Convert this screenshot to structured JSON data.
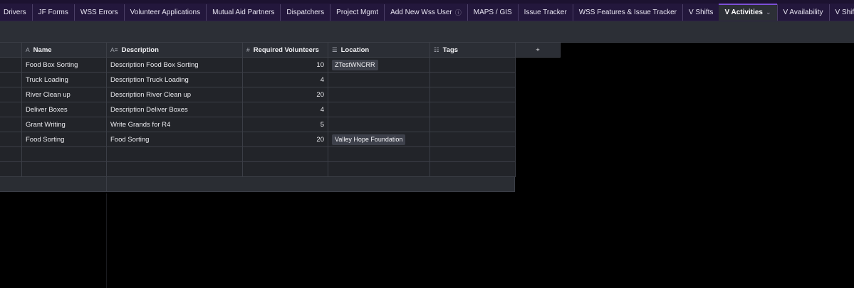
{
  "tabs": [
    {
      "label": "Drivers"
    },
    {
      "label": "JF Forms"
    },
    {
      "label": "WSS Errors"
    },
    {
      "label": "Volunteer Applications"
    },
    {
      "label": "Mutual Aid Partners"
    },
    {
      "label": "Dispatchers"
    },
    {
      "label": "Project Mgmt"
    },
    {
      "label": "Add New Wss User",
      "icon": "info-icon",
      "glyph": "ⓘ"
    },
    {
      "label": "MAPS / GIS"
    },
    {
      "label": "Issue Tracker"
    },
    {
      "label": "WSS Features & Issue Tracker"
    },
    {
      "label": "V Shifts"
    },
    {
      "label": "V Activities",
      "active": true,
      "icon": "chevron-down-icon",
      "glyph": "⌄"
    },
    {
      "label": "V Availability"
    },
    {
      "label": "V Shift Assignment"
    }
  ],
  "tab_overflow": {
    "icon": "chevron-down-icon",
    "glyph": "⌄"
  },
  "tab_add": {
    "icon": "plus-icon",
    "glyph": "+"
  },
  "colors": {
    "tabbar_bg": "#23173c",
    "active_accent": "#7c4fd6",
    "grid_bg": "#222429",
    "grid_border": "#3b3e46"
  },
  "columns": [
    {
      "label": "",
      "icon": ""
    },
    {
      "label": "Name",
      "icon": "text-field-icon",
      "glyph": "A"
    },
    {
      "label": "Description",
      "icon": "long-text-field-icon",
      "glyph": "A≡"
    },
    {
      "label": "Required Volunteers",
      "icon": "number-field-icon",
      "glyph": "#"
    },
    {
      "label": "Location",
      "icon": "link-field-icon",
      "glyph": "☰"
    },
    {
      "label": "Tags",
      "icon": "multi-select-field-icon",
      "glyph": "☷"
    }
  ],
  "add_column": {
    "icon": "plus-icon",
    "glyph": "+"
  },
  "rows": [
    {
      "name": "Food Box Sorting",
      "description": "Description Food Box Sorting",
      "required": "10",
      "location": "ZTestWNCRR",
      "tags": ""
    },
    {
      "name": "Truck Loading",
      "description": "Description Truck Loading",
      "required": "4",
      "location": "",
      "tags": ""
    },
    {
      "name": "River Clean up",
      "description": "Description River Clean up",
      "required": "20",
      "location": "",
      "tags": ""
    },
    {
      "name": "Deliver Boxes",
      "description": "Description Deliver Boxes",
      "required": "4",
      "location": "",
      "tags": ""
    },
    {
      "name": "Grant Writing",
      "description": "Write Grands for R4",
      "required": "5",
      "location": "",
      "tags": ""
    },
    {
      "name": "Food Sorting",
      "description": "Food Sorting",
      "required": "20",
      "location": "Valley Hope Foundation",
      "tags": ""
    },
    {
      "name": "",
      "description": "",
      "required": "",
      "location": "",
      "tags": ""
    },
    {
      "name": "",
      "description": "",
      "required": "",
      "location": "",
      "tags": ""
    }
  ]
}
